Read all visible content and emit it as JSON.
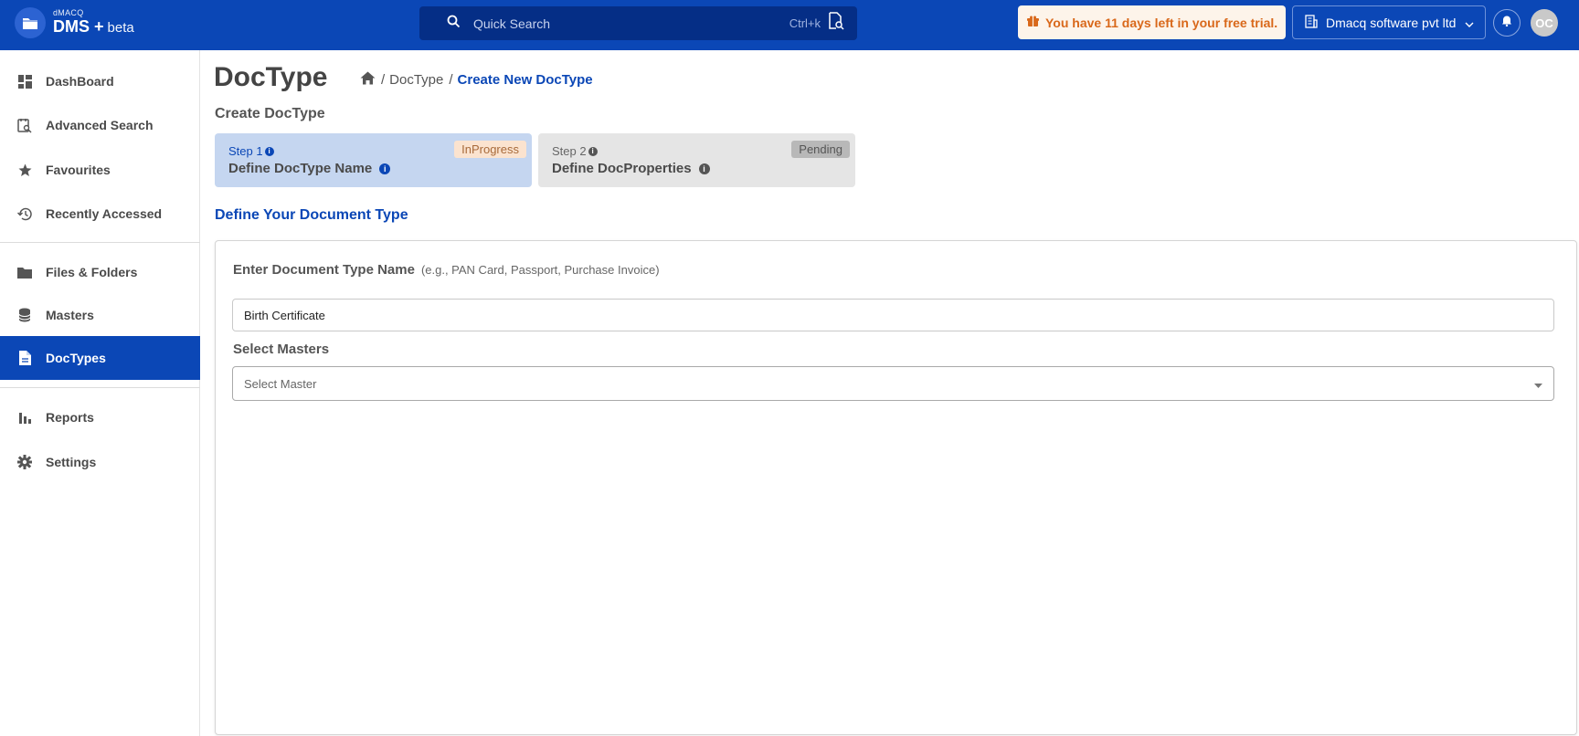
{
  "header": {
    "logo_small": "dMACQ",
    "logo_main": "DMS",
    "logo_plus": "+",
    "logo_beta": "beta",
    "search_placeholder": "Quick Search",
    "search_shortcut": "Ctrl+k",
    "trial_text": "You have 11 days left in your free trial.",
    "company_name": "Dmacq software pvt ltd",
    "avatar_initials": "OC"
  },
  "sidebar": {
    "items": [
      {
        "label": "DashBoard",
        "icon": "dashboard-icon"
      },
      {
        "label": "Advanced Search",
        "icon": "advanced-search-icon"
      },
      {
        "label": "Favourites",
        "icon": "star-icon"
      },
      {
        "label": "Recently Accessed",
        "icon": "history-icon"
      },
      {
        "label": "Files & Folders",
        "icon": "folder-icon"
      },
      {
        "label": "Masters",
        "icon": "database-icon"
      },
      {
        "label": "DocTypes",
        "icon": "document-icon"
      },
      {
        "label": "Reports",
        "icon": "bar-chart-icon"
      },
      {
        "label": "Settings",
        "icon": "gear-icon"
      }
    ],
    "active": "DocTypes"
  },
  "main": {
    "title": "DocType",
    "breadcrumb": {
      "sep1": "/",
      "item1": "DocType",
      "sep2": "/",
      "current": "Create New DocType"
    },
    "subtitle": "Create DocType",
    "steps": [
      {
        "number": "Step 1",
        "title": "Define DocType Name",
        "status": "InProgress"
      },
      {
        "number": "Step 2",
        "title": "Define DocProperties",
        "status": "Pending"
      }
    ],
    "section_heading": "Define Your Document Type",
    "form": {
      "name_label": "Enter Document Type Name",
      "name_hint": "(e.g., PAN Card, Passport, Purchase Invoice)",
      "name_value": "Birth Certificate",
      "masters_label": "Select Masters",
      "masters_placeholder": "Select Master"
    }
  },
  "colors": {
    "brand": "#0b47b6",
    "trial_text": "#d9681a",
    "step_active_bg": "#c5d6f0",
    "step_pending_bg": "#e5e5e5"
  }
}
